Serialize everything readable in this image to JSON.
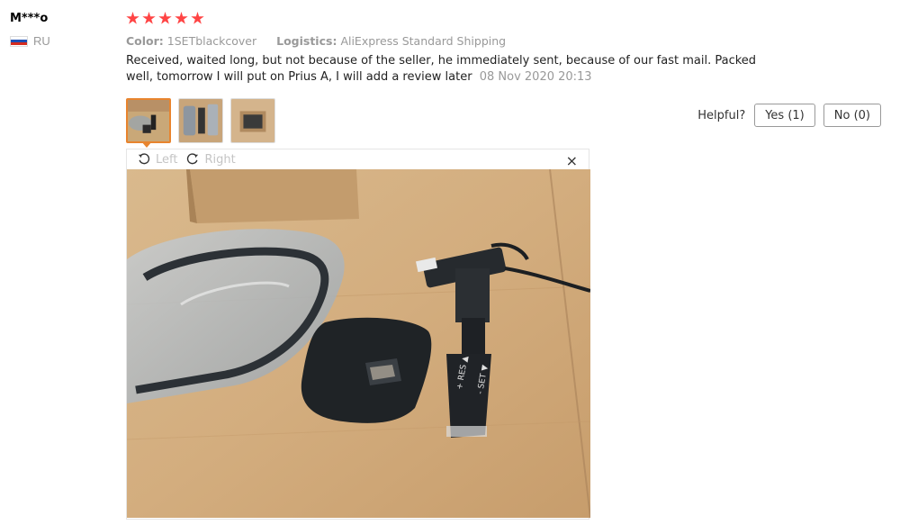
{
  "user": {
    "name": "M***o",
    "country": "RU"
  },
  "review": {
    "rating": 5,
    "color_label": "Color:",
    "color_value": "1SETblackcover",
    "logistics_label": "Logistics:",
    "logistics_value": "AliExpress Standard Shipping",
    "text": "Received, waited long, but not because of the seller, he immediately sent, because of our fast mail. Packed well, tomorrow I will put on Prius A, I will add a review later",
    "date": "08 Nov 2020 20:13"
  },
  "helpful": {
    "label": "Helpful?",
    "yes": "Yes (1)",
    "no": "No (0)"
  },
  "viewer": {
    "rotate_left": "Left",
    "rotate_right": "Right",
    "close": "×"
  },
  "colors": {
    "star": "#ff4444",
    "accent": "#e8842e"
  },
  "icons": [
    "flag-icon",
    "star-icon",
    "rotate-left-icon",
    "rotate-right-icon",
    "close-icon"
  ]
}
